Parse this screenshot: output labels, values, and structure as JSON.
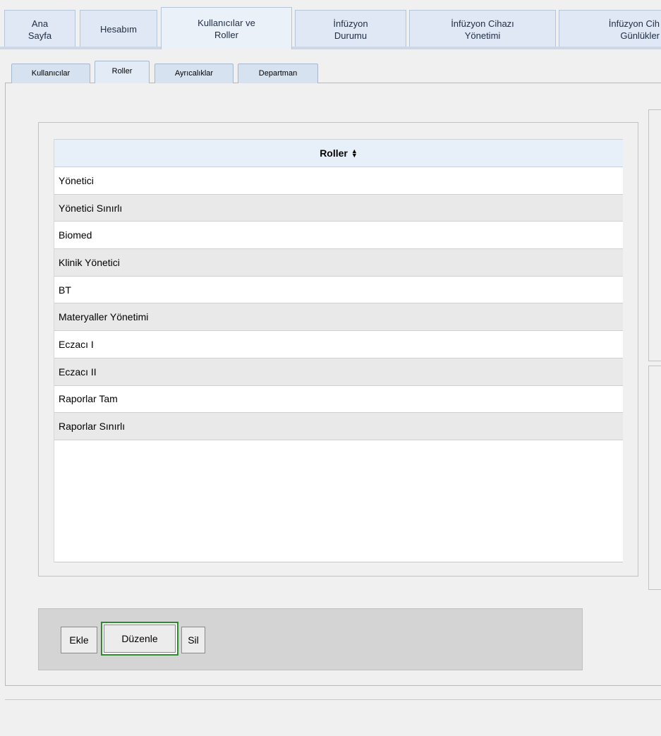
{
  "top_tabs": [
    {
      "label": "Ana\nSayfa"
    },
    {
      "label": "Hesabım"
    },
    {
      "label": "Kullanıcılar ve\nRoller"
    },
    {
      "label": "İnfüzyon\nDurumu"
    },
    {
      "label": "İnfüzyon Cihazı\nYönetimi"
    },
    {
      "label": "İnfüzyon Cih\nGünlükler"
    }
  ],
  "sub_tabs": [
    {
      "label": "Kullanıcılar"
    },
    {
      "label": "Roller"
    },
    {
      "label": "Ayrıcalıklar"
    },
    {
      "label": "Departman"
    }
  ],
  "table": {
    "header": "Roller",
    "sort_icon": "sort-icon",
    "rows": [
      "Yönetici",
      "Yönetici Sınırlı",
      "Biomed",
      "Klinik Yönetici",
      "BT",
      "Materyaller Yönetimi",
      "Eczacı I",
      "Eczacı II",
      "Raporlar Tam",
      "Raporlar Sınırlı"
    ]
  },
  "buttons": {
    "add": "Ekle",
    "edit": "Düzenle",
    "delete": "Sil"
  },
  "colors": {
    "focus_ring": "#2e8b2e",
    "tab_active": "#ebf1f9",
    "header_bg": "#e7f0f8"
  }
}
